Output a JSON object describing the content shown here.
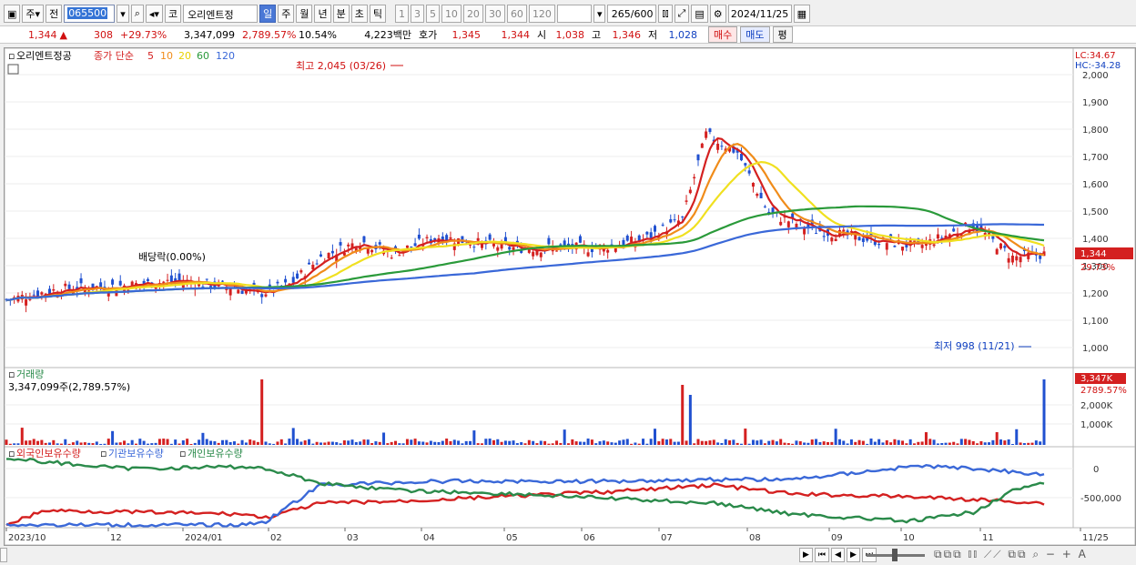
{
  "toolbar": {
    "market": "주",
    "prefix": "전",
    "code": "065500",
    "code_mark": "코",
    "stock_name": "오리엔트정",
    "periods": [
      "일",
      "주",
      "월",
      "년",
      "분",
      "초",
      "틱"
    ],
    "active_period": "일",
    "intervals": [
      "1",
      "3",
      "5",
      "10",
      "20",
      "30",
      "60",
      "120"
    ],
    "count": "265",
    "count_max": "/600",
    "date": "2024/11/25"
  },
  "quote": {
    "price": "1,344",
    "arrow": "▲",
    "change": "308",
    "change_pct": "+29.73%",
    "volume": "3,347,099",
    "volume_pct": "2,789.57%",
    "turnover": "10.54%",
    "amount": "4,223백만",
    "bid_label": "호가",
    "ask": "1,345",
    "bid": "1,344",
    "open_label": "시",
    "open": "1,038",
    "high_label": "고",
    "high": "1,346",
    "low_label": "저",
    "low": "1,028",
    "buy_label": "매수",
    "sell_label": "매도",
    "avg_label": "평"
  },
  "price_panel": {
    "stock_name": "오리엔트정공",
    "legend_prefix": "종가 단순",
    "ma": [
      {
        "period": "5",
        "color": "#d42020"
      },
      {
        "period": "10",
        "color": "#f08c1a"
      },
      {
        "period": "20",
        "color": "#f0e020"
      },
      {
        "period": "60",
        "color": "#2a9a3a"
      },
      {
        "period": "120",
        "color": "#3a68d8"
      }
    ],
    "lc": "LC:34.67",
    "hc": "HC:-34.28",
    "high_annotation": "최고 2,045 (03/26)",
    "low_annotation": "최저 998 (11/21)",
    "dividend_annotation": "배당락(0.00%)",
    "price_tag": "1,344",
    "price_tag_pct": "29.73%",
    "yaxis": [
      "2,000",
      "1,900",
      "1,800",
      "1,700",
      "1,600",
      "1,500",
      "1,400",
      "1,300",
      "1,200",
      "1,100",
      "1,000"
    ]
  },
  "volume_panel": {
    "title": "거래량",
    "value": "3,347,099주(2,789.57%)",
    "tag": "3,347K",
    "tag_pct": "2789.57%",
    "yaxis": [
      "2,000K",
      "1,000K"
    ]
  },
  "holdings_panel": {
    "legend": [
      {
        "name": "외국인보유수량",
        "color": "#d42020"
      },
      {
        "name": "기관보유수량",
        "color": "#3a68d8"
      },
      {
        "name": "개인보유수량",
        "color": "#2a8a4a"
      }
    ],
    "yaxis": [
      "0",
      "-500,000"
    ]
  },
  "xaxis": [
    "2023/10",
    "12",
    "2024/01",
    "02",
    "03",
    "04",
    "05",
    "06",
    "07",
    "08",
    "09",
    "10",
    "11",
    "11/25"
  ]
}
